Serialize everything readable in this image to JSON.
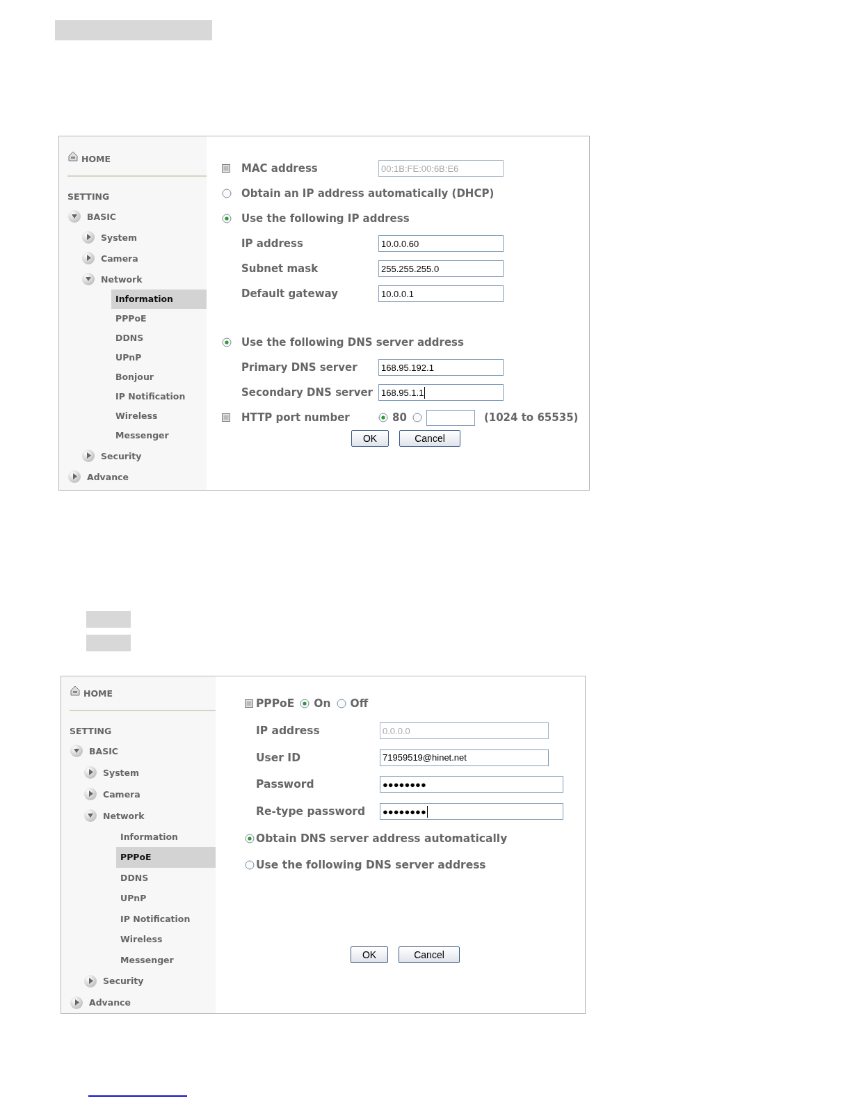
{
  "screenshots": [
    {
      "sidebar": {
        "home": "HOME",
        "heading": "SETTING",
        "items": [
          {
            "label": "BASIC",
            "expanded": true,
            "children": [
              {
                "label": "System",
                "expanded": false
              },
              {
                "label": "Camera",
                "expanded": false
              },
              {
                "label": "Network",
                "expanded": true,
                "children": [
                  {
                    "label": "Information",
                    "selected": true
                  },
                  {
                    "label": "PPPoE",
                    "selected": false
                  },
                  {
                    "label": "DDNS",
                    "selected": false
                  },
                  {
                    "label": "UPnP",
                    "selected": false
                  },
                  {
                    "label": "Bonjour",
                    "selected": false
                  },
                  {
                    "label": "IP Notification",
                    "selected": false
                  },
                  {
                    "label": "Wireless",
                    "selected": false
                  },
                  {
                    "label": "Messenger",
                    "selected": false
                  }
                ]
              },
              {
                "label": "Security",
                "expanded": false
              }
            ]
          },
          {
            "label": "Advance",
            "expanded": false
          }
        ]
      },
      "form": {
        "groups": [
          {
            "rows": [
              {
                "kind": "field",
                "bullet": true,
                "label": "MAC address",
                "value": "00:1B:FE:00:6B:E6",
                "disabled": true,
                "focused": false
              },
              {
                "kind": "radio",
                "label": "Obtain an IP address automatically (DHCP)",
                "selected": false
              },
              {
                "kind": "radio",
                "label": "Use the following IP address",
                "selected": true
              },
              {
                "kind": "field",
                "label": "IP address",
                "value": "10.0.0.60",
                "disabled": false,
                "focused": false
              },
              {
                "kind": "field",
                "label": "Subnet mask",
                "value": "255.255.255.0",
                "disabled": false,
                "focused": false
              },
              {
                "kind": "field",
                "label": "Default gateway",
                "value": "10.0.0.1",
                "disabled": false,
                "focused": false
              }
            ]
          },
          {
            "rows": [
              {
                "kind": "radio",
                "label": "Use the following DNS server address",
                "selected": true
              },
              {
                "kind": "field",
                "label": "Primary DNS server",
                "value": "168.95.192.1",
                "disabled": false,
                "focused": false
              },
              {
                "kind": "field",
                "label": "Secondary DNS server",
                "value": "168.95.1.1",
                "disabled": false,
                "focused": true
              },
              {
                "kind": "choice",
                "bullet": true,
                "label": "HTTP port number",
                "options": [
                  {
                    "kind": "radio",
                    "label": "80",
                    "selected": true
                  },
                  {
                    "kind": "radio_input",
                    "selected": false
                  }
                ],
                "hint": "(1024 to 65535)"
              }
            ]
          }
        ],
        "buttons": [
          {
            "label": "OK"
          },
          {
            "label": "Cancel"
          }
        ]
      }
    },
    {
      "sidebar": {
        "home": "HOME",
        "heading": "SETTING",
        "items": [
          {
            "label": "BASIC",
            "expanded": true,
            "children": [
              {
                "label": "System",
                "expanded": false
              },
              {
                "label": "Camera",
                "expanded": false
              },
              {
                "label": "Network",
                "expanded": true,
                "children": [
                  {
                    "label": "Information",
                    "selected": false
                  },
                  {
                    "label": "PPPoE",
                    "selected": true
                  },
                  {
                    "label": "DDNS",
                    "selected": false
                  },
                  {
                    "label": "UPnP",
                    "selected": false
                  },
                  {
                    "label": "IP Notification",
                    "selected": false
                  },
                  {
                    "label": "Wireless",
                    "selected": false
                  },
                  {
                    "label": "Messenger",
                    "selected": false
                  }
                ]
              },
              {
                "label": "Security",
                "expanded": false
              }
            ]
          },
          {
            "label": "Advance",
            "expanded": false
          }
        ]
      },
      "form": {
        "groups": [
          {
            "rows": [
              {
                "kind": "toggle",
                "bullet": true,
                "label": "PPPoE",
                "options": [
                  {
                    "kind": "radio",
                    "label": "On",
                    "selected": true
                  },
                  {
                    "kind": "radio",
                    "label": "Off",
                    "selected": false
                  }
                ]
              },
              {
                "kind": "field",
                "label": "IP address",
                "value": "0.0.0.0",
                "disabled": true,
                "focused": false
              },
              {
                "kind": "field",
                "label": "User ID",
                "value": "71959519@hinet.net",
                "disabled": false,
                "focused": false
              },
              {
                "kind": "password",
                "label": "Password",
                "value": "●●●●●●●●",
                "disabled": false,
                "focused": false
              },
              {
                "kind": "password",
                "label": "Re-type password",
                "value": "●●●●●●●●",
                "disabled": false,
                "focused": true
              },
              {
                "kind": "radio",
                "label": "Obtain DNS server address automatically",
                "selected": true
              },
              {
                "kind": "radio",
                "label": "Use the following DNS server address",
                "selected": false
              }
            ]
          }
        ],
        "buttons": [
          {
            "label": "OK"
          },
          {
            "label": "Cancel"
          }
        ]
      }
    }
  ]
}
